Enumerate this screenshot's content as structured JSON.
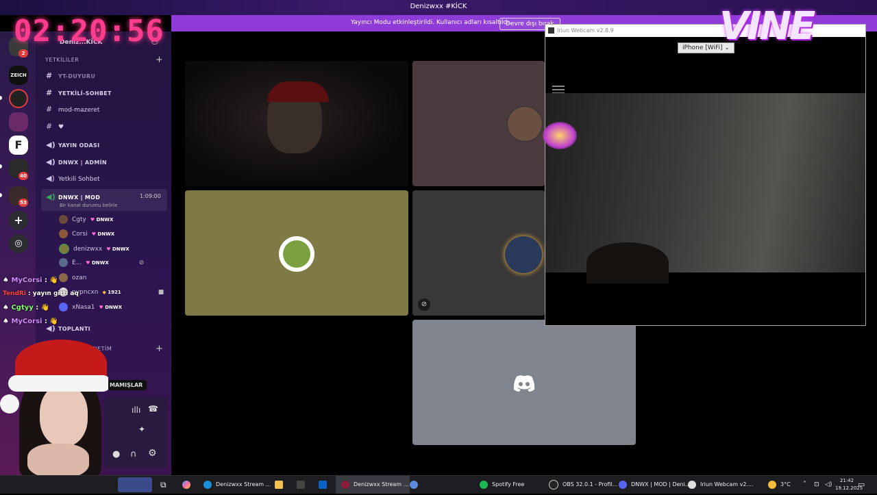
{
  "window_title": "Denizwxx #KİCK",
  "overlay": {
    "clock": "02:20:56",
    "logo_text": "VINE"
  },
  "banner": {
    "text": "Yayıncı Modu etkinleştirildi. Kullanıcı adları kısaltıldı.",
    "button": "Devre dışı bırak"
  },
  "servers": {
    "badges": [
      "2",
      "40",
      "53"
    ],
    "labels": [
      "ZEICH",
      "F"
    ]
  },
  "sidebar": {
    "server_name": "Deniz...KİCK",
    "category_1": "YETKİLİLER",
    "channels": [
      {
        "icon": "#",
        "name": "YT-DUYURU"
      },
      {
        "icon": "#",
        "name": "YETKİLİ-SOHBET"
      },
      {
        "icon": "#",
        "name": "mod-mazeret"
      },
      {
        "icon": "#",
        "name": "♥"
      },
      {
        "icon": "🔊",
        "name": "YAYIN ODASI"
      },
      {
        "icon": "🔊",
        "name": "DNWX | ADMİN"
      },
      {
        "icon": "🔊",
        "name": "Yetkili Sohbet"
      },
      {
        "icon": "🔊",
        "name": "DNWX | MOD"
      },
      {
        "icon": "🔊",
        "name": "TOPLANTI"
      }
    ],
    "active_channel_time": "1:09:00",
    "active_channel_status": "Bir kanal durumu belirle",
    "members": [
      {
        "name": "Cgty",
        "tag": "DNWX"
      },
      {
        "name": "Corsi",
        "tag": "DNWX"
      },
      {
        "name": "denizwxx",
        "tag": "DNWX"
      },
      {
        "name": "E...",
        "tag": "DNWX"
      },
      {
        "name": "ozan",
        "tag": ""
      },
      {
        "name": "pypncxn",
        "tag": "1921"
      },
      {
        "name": "xNasa1",
        "tag": "DNWX"
      }
    ],
    "category_2": "& YÖNETİM",
    "tooltip": "MAMIŞLAR"
  },
  "chat": [
    {
      "user": "MyCorsi",
      "color": "#d58bff",
      "msg": ""
    },
    {
      "user": "TendRi",
      "color": "#ff4545",
      "msg": "yayın gitti aq"
    },
    {
      "user": "Cgtyy",
      "color": "#7dff6a",
      "msg": ""
    },
    {
      "user": "MyCorsi",
      "color": "#d58bff",
      "msg": ""
    }
  ],
  "webcam": {
    "title": "Iriun Webcam v2.8.9",
    "source": "iPhone [WiFi]"
  },
  "taskbar": {
    "items": [
      {
        "label": "Denizwxx Stream ...",
        "color": "#1b8fd8"
      },
      {
        "label": "Denizwxx Stream ...",
        "color": "#8a1d3a"
      },
      {
        "label": "Spotify Free",
        "color": "#1db954"
      },
      {
        "label": "OBS 32.0.1 - Profil...",
        "color": "#333"
      },
      {
        "label": "DNWX | MOD | Deni...",
        "color": "#5865f2"
      },
      {
        "label": "Iriun Webcam v2....",
        "color": "#ddd"
      }
    ],
    "weather": "3°C",
    "time": "21:42",
    "date": "19.12.2025"
  }
}
